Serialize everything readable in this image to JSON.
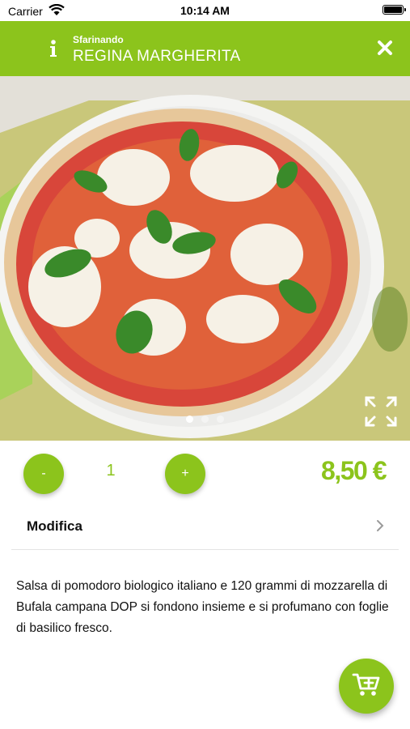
{
  "status_bar": {
    "carrier": "Carrier",
    "time": "10:14 AM"
  },
  "header": {
    "restaurant": "Sfarinando",
    "product_name": "REGINA MARGHERITA"
  },
  "gallery": {
    "page_count": 3,
    "active_page": 1
  },
  "quantity": {
    "minus_label": "-",
    "value": "1",
    "plus_label": "+"
  },
  "price": "8,50 €",
  "modify": {
    "label": "Modifica"
  },
  "description": "Salsa di pomodoro biologico italiano e 120 grammi di mozzarella di Bufala campana DOP si fondono insieme e si profumano con foglie di basilico fresco.",
  "colors": {
    "accent": "#8cc41c",
    "header_text": "#ffffff",
    "divider": "#e4e4e4"
  },
  "icons": [
    "wifi-icon",
    "battery-icon",
    "info-icon",
    "close-icon",
    "expand-icon",
    "chevron-right-icon",
    "add-to-cart-icon"
  ]
}
